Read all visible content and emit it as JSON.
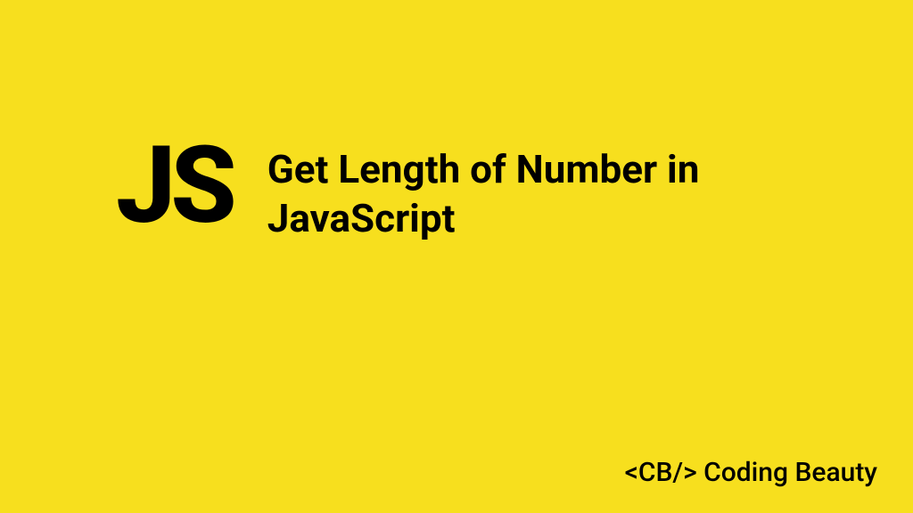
{
  "logo": "JS",
  "title": "Get Length of Number in JavaScript",
  "brand": "<CB/> Coding Beauty",
  "colors": {
    "background": "#f7df1e",
    "text": "#000000"
  }
}
